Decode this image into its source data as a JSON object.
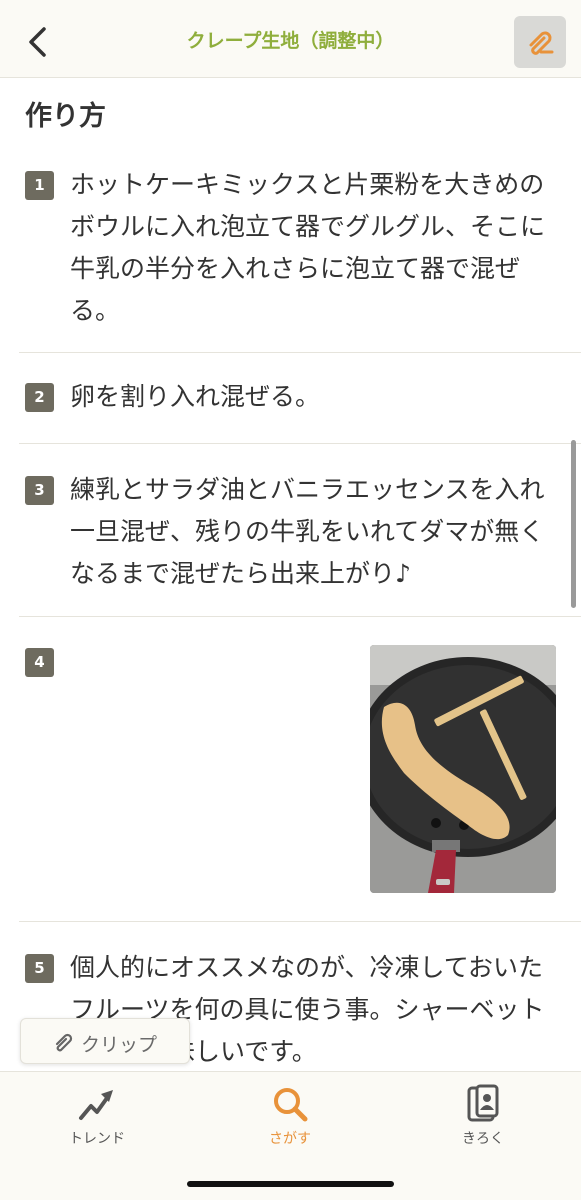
{
  "header": {
    "title": "クレープ生地（調整中）",
    "back_icon": "chevron-left-icon",
    "clip_icon": "paperclip-icon"
  },
  "section": {
    "title": "作り方"
  },
  "steps": [
    {
      "number": "1",
      "text": "ホットケーキミックスと片栗粉を大きめのボウルに入れ泡立て器でグルグル、そこに牛乳の半分を入れさらに泡立て器で混ぜる。"
    },
    {
      "number": "2",
      "text": "卵を割り入れ混ぜる。"
    },
    {
      "number": "3",
      "text": "練乳とサラダ油とバニラエッセンスを入れ一旦混ぜ、残りの牛乳をいれてダマが無くなるまで混ぜたら出来上がり♪"
    },
    {
      "number": "4",
      "text": ""
    },
    {
      "number": "5",
      "text": "個人的にオススメなのが、冷凍しておいたフルーツを何の具に使う事。シャーベットになり美味しいです。"
    }
  ],
  "clip_button": {
    "label": "クリップ",
    "icon": "paperclip-icon"
  },
  "bottom_nav": {
    "items": [
      {
        "label": "トレンド",
        "icon": "trend-arrow-icon",
        "active": false
      },
      {
        "label": "さがす",
        "icon": "search-icon",
        "active": true
      },
      {
        "label": "きろく",
        "icon": "record-card-icon",
        "active": false
      }
    ]
  },
  "colors": {
    "title_green": "#8fae3c",
    "accent_orange": "#e8923a",
    "step_badge": "#6e6b5f"
  }
}
